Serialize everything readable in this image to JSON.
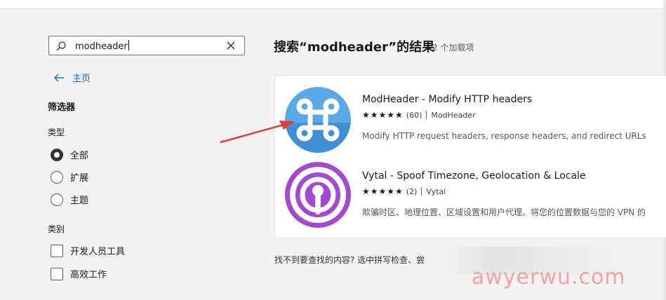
{
  "search": {
    "value": "modheader"
  },
  "nav": {
    "back_label": "主页"
  },
  "filters": {
    "heading": "筛选器",
    "type_heading": "类型",
    "type_options": [
      "全部",
      "扩展",
      "主题"
    ],
    "type_selected": "全部",
    "category_heading": "类别",
    "category_options": [
      "开发人员工具",
      "高效工作"
    ]
  },
  "results": {
    "title": "搜索“modheader”的结果",
    "count": "2 个加载项",
    "items": [
      {
        "name": "ModHeader - Modify HTTP headers",
        "stars": "★★★★★",
        "rating_count": "(60)",
        "publisher": "ModHeader",
        "description": "Modify HTTP request headers, response headers, and redirect URLs",
        "icon": "command-key-icon"
      },
      {
        "name": "Vytal - Spoof Timezone, Geolocation & Locale",
        "stars": "★★★★★",
        "rating_count": "(2)",
        "publisher": "Vytal",
        "description": "欺骗时区、地理位置、区域设置和用户代理。将您的位置数据与您的 VPN 的",
        "icon": "location-pin-icon"
      }
    ]
  },
  "footer_note": "找不到要查找的内容? 选中拼写检查、尝",
  "watermark": "awyerwu.com",
  "colors": {
    "accent": "#0f6cbd",
    "annotation_arrow": "#e53935",
    "watermark": "#f4a3a1"
  }
}
